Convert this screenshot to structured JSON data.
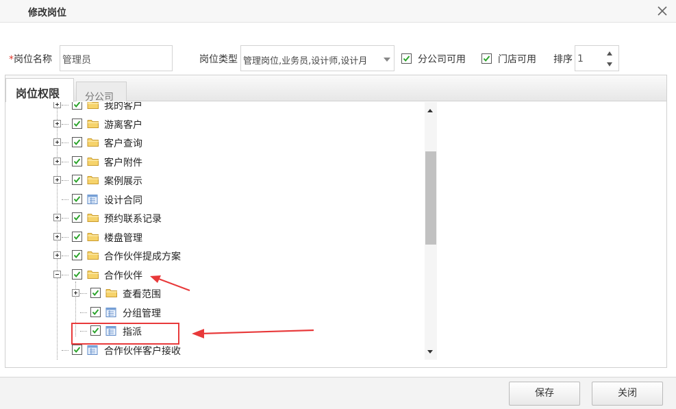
{
  "dialog": {
    "title": "修改岗位"
  },
  "form": {
    "name_label": "岗位名称",
    "name_required_mark": "*",
    "name_value": "管理员",
    "type_label": "岗位类型",
    "type_value": "管理岗位,业务员,设计师,设计月",
    "branch_checkbox_label": "分公司可用",
    "branch_checked": true,
    "store_checkbox_label": "门店可用",
    "store_checked": true,
    "sort_label": "排序",
    "sort_value": "1"
  },
  "tabs": [
    {
      "label": "岗位权限",
      "active": true
    },
    {
      "label": "分公司",
      "active": false
    }
  ],
  "tree": {
    "nodes": [
      {
        "label": "我的客户",
        "kind": "folder",
        "expander": "plus",
        "checked": true,
        "level": 0
      },
      {
        "label": "游离客户",
        "kind": "folder",
        "expander": "plus",
        "checked": true,
        "level": 0
      },
      {
        "label": "客户查询",
        "kind": "folder",
        "expander": "plus",
        "checked": true,
        "level": 0
      },
      {
        "label": "客户附件",
        "kind": "folder",
        "expander": "plus",
        "checked": true,
        "level": 0
      },
      {
        "label": "案例展示",
        "kind": "folder",
        "expander": "plus",
        "checked": true,
        "level": 0
      },
      {
        "label": "设计合同",
        "kind": "page",
        "expander": "none",
        "checked": true,
        "level": 0
      },
      {
        "label": "预约联系记录",
        "kind": "folder",
        "expander": "plus",
        "checked": true,
        "level": 0
      },
      {
        "label": "楼盘管理",
        "kind": "folder",
        "expander": "plus",
        "checked": true,
        "level": 0
      },
      {
        "label": "合作伙伴提成方案",
        "kind": "folder",
        "expander": "plus",
        "checked": true,
        "level": 0
      },
      {
        "label": "合作伙伴",
        "kind": "folder",
        "expander": "minus",
        "checked": true,
        "level": 0
      },
      {
        "label": "查看范围",
        "kind": "folder",
        "expander": "plus",
        "checked": true,
        "level": 1
      },
      {
        "label": "分组管理",
        "kind": "page",
        "expander": "none",
        "checked": true,
        "level": 1
      },
      {
        "label": "指派",
        "kind": "page",
        "expander": "none",
        "checked": true,
        "level": 1
      },
      {
        "label": "合作伙伴客户接收",
        "kind": "page",
        "expander": "none",
        "checked": true,
        "level": 0
      }
    ]
  },
  "footer": {
    "save_label": "保存",
    "close_label": "关闭"
  },
  "colors": {
    "check_green": "#2aa32a",
    "annotation_red": "#e8393a",
    "folder_yellow": "#f6d36b"
  },
  "icons": {
    "close": "close-icon",
    "folder": "folder-icon",
    "page": "page-icon"
  }
}
